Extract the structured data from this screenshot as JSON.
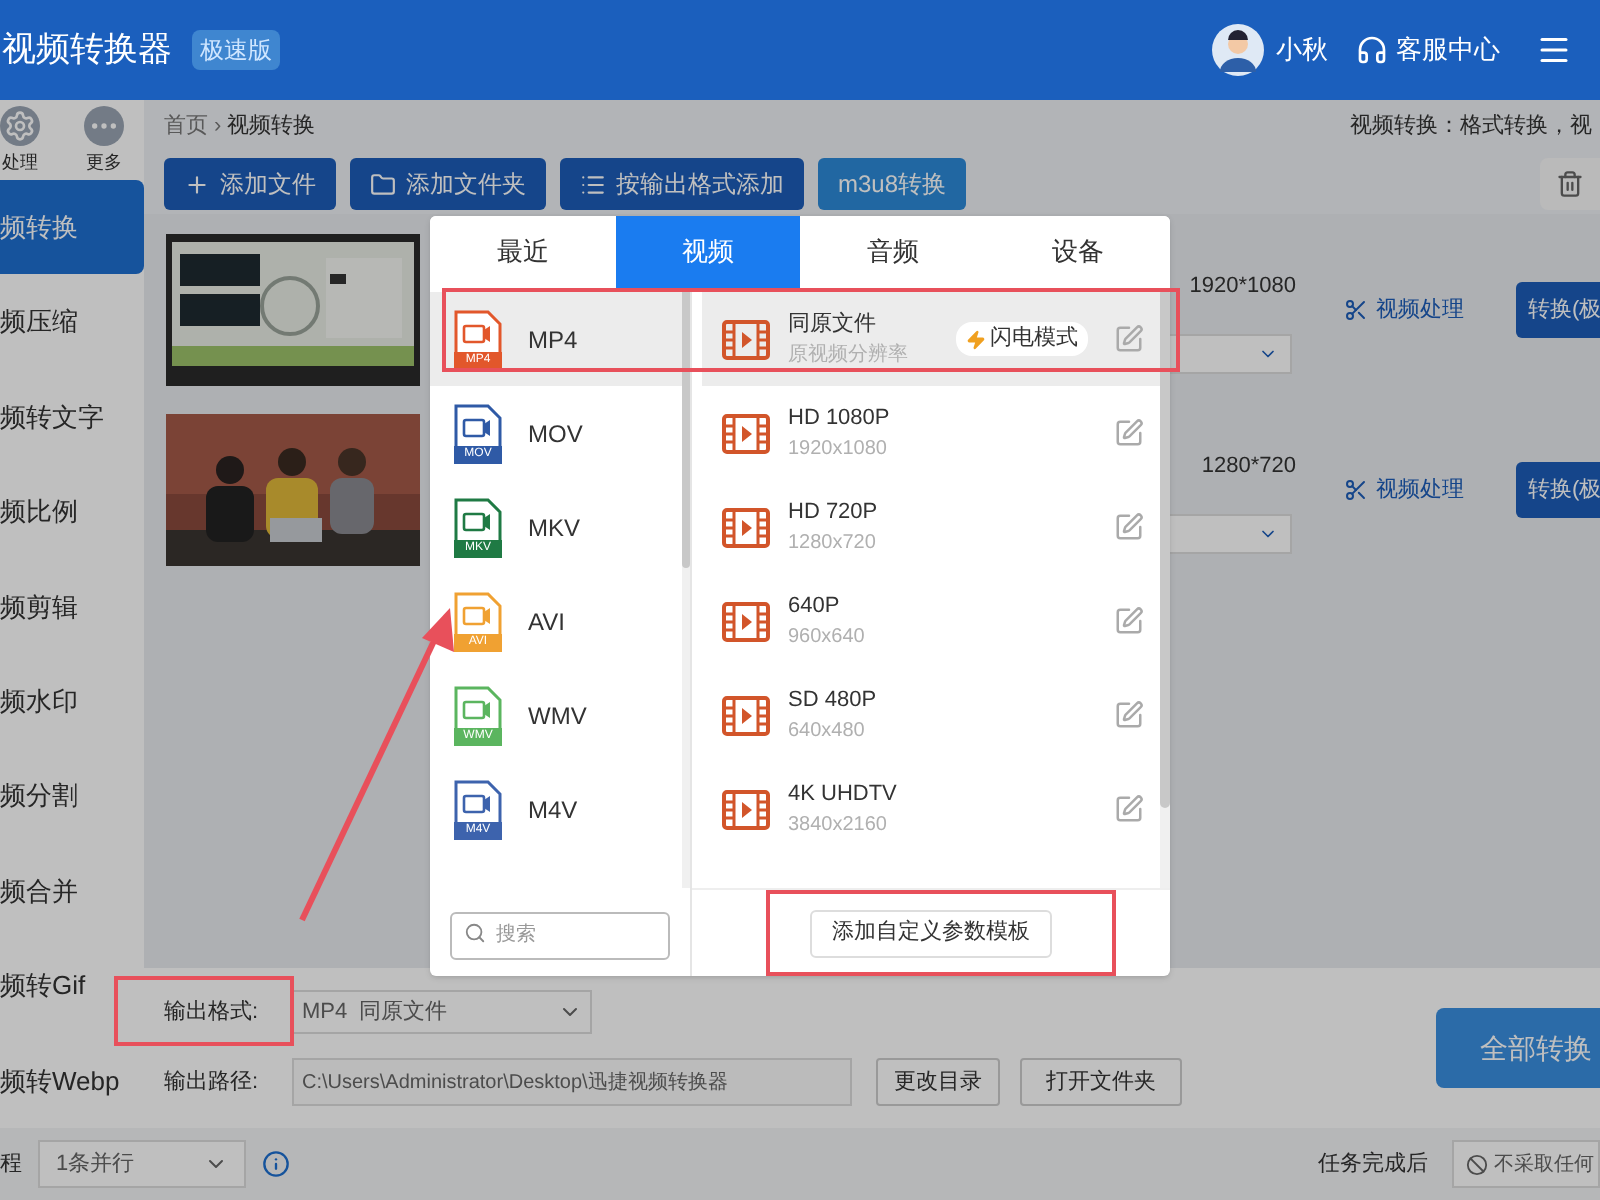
{
  "app": {
    "title": "视频转换器",
    "badge": "极速版",
    "user": "小秋",
    "support": "客服中心"
  },
  "sidebar": {
    "top_items": [
      {
        "label": "处理"
      },
      {
        "label": "更多"
      }
    ],
    "items": [
      {
        "label": "频转换",
        "selected": true
      },
      {
        "label": "频压缩",
        "selected": false
      },
      {
        "label": "频转文字",
        "selected": false
      },
      {
        "label": "频比例",
        "selected": false
      },
      {
        "label": "频剪辑",
        "selected": false
      },
      {
        "label": "频水印",
        "selected": false
      },
      {
        "label": "频分割",
        "selected": false
      },
      {
        "label": "频合并",
        "selected": false
      },
      {
        "label": "频转Gif",
        "selected": false
      },
      {
        "label": "频转Webp",
        "selected": false
      }
    ]
  },
  "breadcrumb": {
    "home": "首页",
    "separator": "›",
    "current": "视频转换"
  },
  "description": "视频转换：格式转换，视",
  "toolbar": [
    {
      "label": "添加文件",
      "kind": "primary"
    },
    {
      "label": "添加文件夹",
      "kind": "primary"
    },
    {
      "label": "按输出格式添加",
      "kind": "primary"
    },
    {
      "label": "m3u8转换",
      "kind": "secondary"
    }
  ],
  "files": [
    {
      "resolution": "1920*1080",
      "action": "视频处理",
      "convert": "转换(极"
    },
    {
      "resolution": "1280*720",
      "action": "视频处理",
      "convert": "转换(极"
    }
  ],
  "output": {
    "format_label": "输出格式:",
    "format_value": "MP4  同原文件",
    "path_label": "输出路径:",
    "path": "C:\\Users\\Administrator\\Desktop\\迅捷视频转换器",
    "change_dir": "更改目录",
    "open_folder": "打开文件夹",
    "convert_all": "全部转换"
  },
  "status_bar": {
    "label": "程",
    "parallel": "1条并行",
    "after_label": "任务完成后",
    "after_value": "不采取任何"
  },
  "format_dialog": {
    "tabs": [
      {
        "label": "最近",
        "selected": false
      },
      {
        "label": "视频",
        "selected": true
      },
      {
        "label": "音频",
        "selected": false
      },
      {
        "label": "设备",
        "selected": false
      }
    ],
    "formats": [
      {
        "name": "MP4",
        "tag": "MP4",
        "color": "#e2572b",
        "selected": true
      },
      {
        "name": "MOV",
        "tag": "MOV",
        "color": "#2f5aa6",
        "selected": false
      },
      {
        "name": "MKV",
        "tag": "MKV",
        "color": "#1f7a44",
        "selected": false
      },
      {
        "name": "AVI",
        "tag": "AVI",
        "color": "#f0a132",
        "selected": false
      },
      {
        "name": "WMV",
        "tag": "WMV",
        "color": "#5bb55f",
        "selected": false
      },
      {
        "name": "M4V",
        "tag": "M4V",
        "color": "#3d63ad",
        "selected": false
      }
    ],
    "search_placeholder": "搜索",
    "presets": [
      {
        "name": "同原文件",
        "detail": "原视频分辨率",
        "badge": "闪电模式",
        "selected": true
      },
      {
        "name": "HD 1080P",
        "detail": "1920x1080",
        "selected": false
      },
      {
        "name": "HD 720P",
        "detail": "1280x720",
        "selected": false
      },
      {
        "name": "640P",
        "detail": "960x640",
        "selected": false
      },
      {
        "name": "SD 480P",
        "detail": "640x480",
        "selected": false
      },
      {
        "name": "4K UHDTV",
        "detail": "3840x2160",
        "selected": false
      }
    ],
    "add_template": "添加自定义参数模板"
  }
}
